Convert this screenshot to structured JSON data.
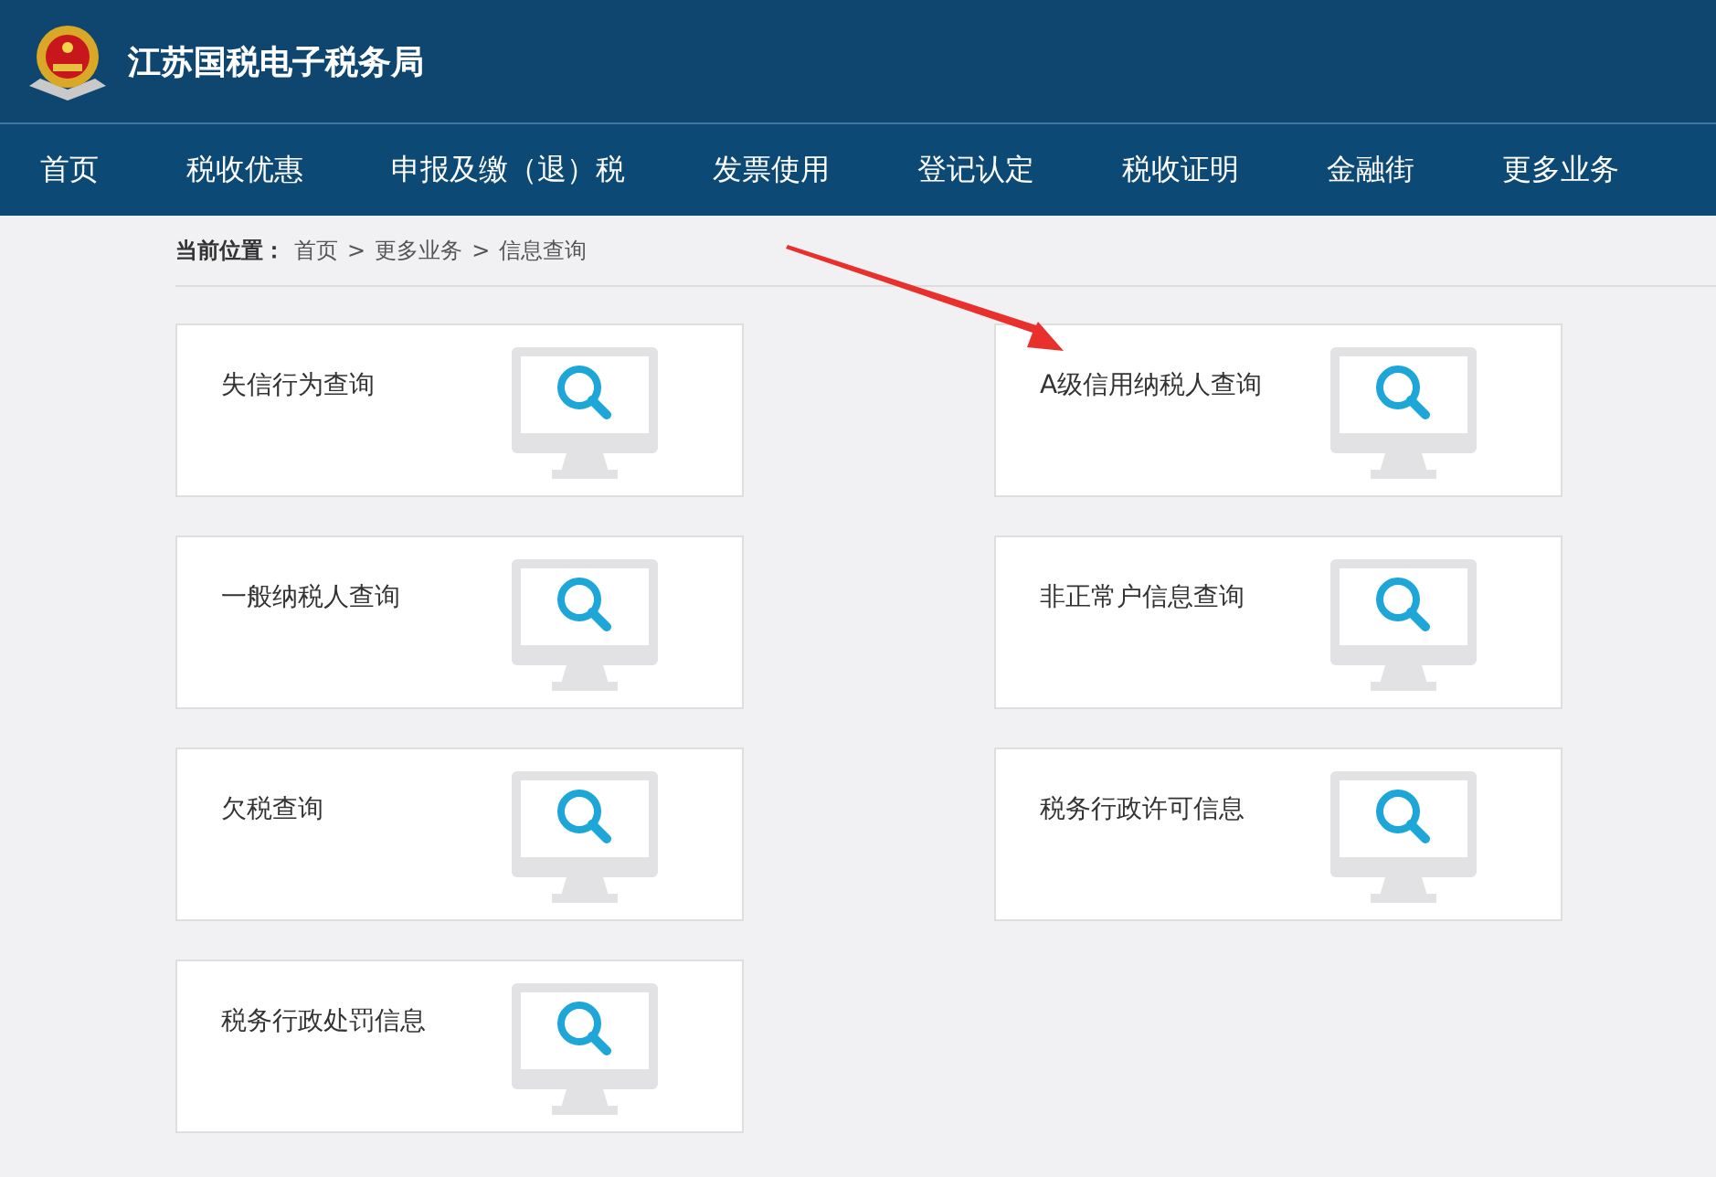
{
  "header": {
    "title": "江苏国税电子税务局"
  },
  "nav": [
    "首页",
    "税收优惠",
    "申报及缴（退）税",
    "发票使用",
    "登记认定",
    "税收证明",
    "金融街",
    "更多业务"
  ],
  "breadcrumb": {
    "label": "当前位置：",
    "separator": ">",
    "items": [
      "首页",
      "更多业务",
      "信息查询"
    ]
  },
  "cards": [
    {
      "title": "失信行为查询"
    },
    {
      "title": "A级信用纳税人查询"
    },
    {
      "title": "一般纳税人查询"
    },
    {
      "title": "非正常户信息查询"
    },
    {
      "title": "欠税查询"
    },
    {
      "title": "税务行政许可信息"
    },
    {
      "title": "税务行政处罚信息"
    }
  ]
}
